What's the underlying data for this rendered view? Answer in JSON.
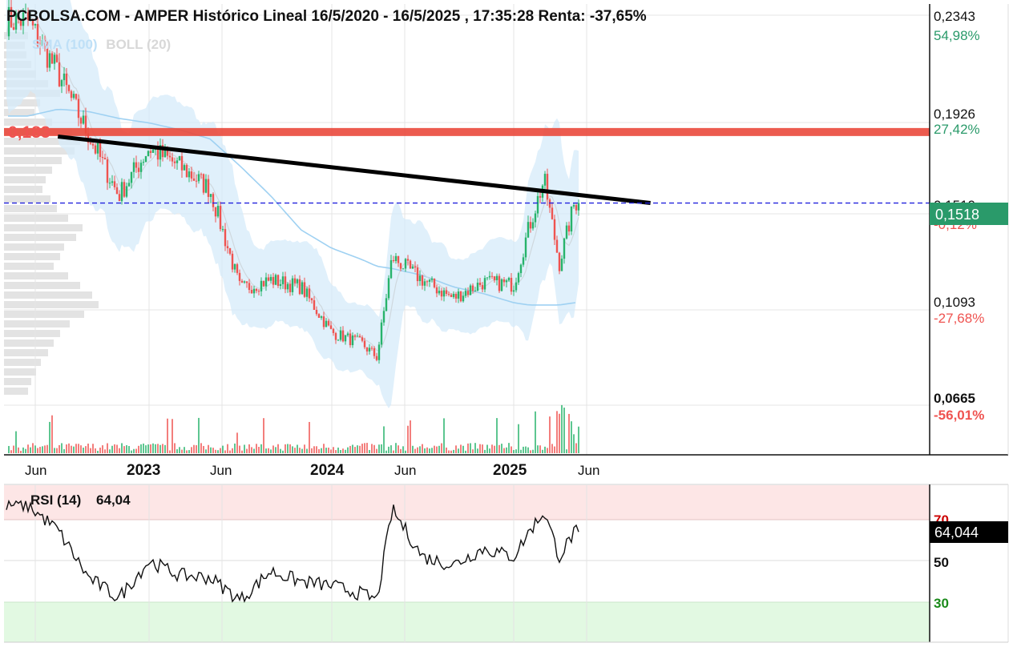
{
  "header": {
    "title": "PCBOLSA.COM - AMPER Histórico Lineal 16/5/2020 - 16/5/2025 , 17:35:28 Renta: -37,65%"
  },
  "indicators": {
    "sma_label": "SMA (100)",
    "boll_label": "BOLL (20)",
    "sma_color": "#bfe0f7",
    "boll_color": "#d8d8d8"
  },
  "colors": {
    "up": "#27b36b",
    "down": "#ef5350",
    "band_fill": "#d6ebfa",
    "sma_line": "#9fd1f2",
    "support_line": "#ea4a3c",
    "trend_line": "#000000",
    "current_line": "#2222dd",
    "current_badge": "#2a9a6a",
    "overbought_zone": "#fde6e6",
    "oversold_zone": "#e2f9e2",
    "volume_profile": "#dedede"
  },
  "x_axis": {
    "labels": [
      {
        "text": "Jun",
        "bold": false
      },
      {
        "text": "2023",
        "bold": true
      },
      {
        "text": "Jun",
        "bold": false
      },
      {
        "text": "2024",
        "bold": true
      },
      {
        "text": "Jun",
        "bold": false
      },
      {
        "text": "2025",
        "bold": true
      },
      {
        "text": "Jun",
        "bold": false
      }
    ]
  },
  "price_axis": {
    "levels": [
      {
        "price": "0,2343",
        "pct": "54,98%",
        "pct_color": "#2a9a6a",
        "bold": false
      },
      {
        "price": "0,1926",
        "pct": "27,42%",
        "pct_color": "#2a9a6a",
        "bold": false
      },
      {
        "price": "0,1093",
        "pct": "-27,68%",
        "pct_color": "#ef5350",
        "bold": false
      },
      {
        "price": "0,0665",
        "pct": "-56,01%",
        "pct_color": "#ef5350",
        "bold": true
      }
    ],
    "hidden_level": {
      "price": "0,1510",
      "pct": "-0,12%"
    }
  },
  "annotations": {
    "support_level": 0.183,
    "support_label": "0,183",
    "current_price": 0.1518,
    "current_label": "0,1518"
  },
  "rsi": {
    "label": "RSI (14)",
    "value": "64,04",
    "badge": "64,044",
    "levels": [
      "70",
      "50",
      "30"
    ],
    "level_colors": [
      "#cc0000",
      "#111111",
      "#1a8a1a"
    ]
  },
  "chart_data": [
    {
      "type": "line",
      "title": "PCBOLSA.COM - AMPER Histórico Lineal 16/5/2020 - 16/5/2025 , 17:35:28 Renta: -37,65%",
      "x": [
        "2022-05",
        "2022-07",
        "2022-09",
        "2022-11",
        "2023-01",
        "2023-03",
        "2023-05",
        "2023-07",
        "2023-09",
        "2023-11",
        "2024-01",
        "2024-03",
        "2024-04",
        "2024-05",
        "2024-07",
        "2024-09",
        "2024-11",
        "2025-01",
        "2025-02",
        "2025-03",
        "2025-04",
        "2025-05"
      ],
      "series": [
        {
          "name": "",
          "values": [
            0.232,
            0.209,
            0.182,
            0.155,
            0.176,
            0.168,
            0.158,
            0.114,
            0.118,
            0.115,
            0.095,
            0.09,
            0.084,
            0.128,
            0.118,
            0.11,
            0.117,
            0.116,
            0.141,
            0.162,
            0.125,
            0.152
          ]
        },
        {
          "name": "SMA (100)",
          "values": [
            0.19,
            0.193,
            0.192,
            0.189,
            0.187,
            0.184,
            0.18,
            0.168,
            0.155,
            0.14,
            0.132,
            0.127,
            0.124,
            0.123,
            0.12,
            0.115,
            0.112,
            0.108,
            0.107,
            0.107,
            0.107,
            0.108
          ]
        }
      ],
      "ylim": [
        0.0665,
        0.2343
      ],
      "y_tick_labels": [
        "0,2343",
        "0,1926",
        "0,1510",
        "0,1093",
        "0,0665"
      ],
      "x_tick_labels": [
        "Jun",
        "2023",
        "Jun",
        "2024",
        "Jun",
        "2025",
        "Jun"
      ],
      "horizontal_lines": [
        0.183,
        0.1518
      ],
      "trend_line": {
        "from": [
          "2022-07",
          0.181
        ],
        "to": [
          "2025-10",
          0.1518
        ]
      },
      "grid": true,
      "legend": "top-left"
    },
    {
      "type": "line",
      "title": "RSI (14)",
      "x": [
        "2022-05",
        "2022-07",
        "2022-09",
        "2022-11",
        "2023-01",
        "2023-03",
        "2023-05",
        "2023-07",
        "2023-09",
        "2023-11",
        "2024-01",
        "2024-03",
        "2024-04",
        "2024-05",
        "2024-07",
        "2024-09",
        "2024-11",
        "2025-01",
        "2025-02",
        "2025-03",
        "2025-04",
        "2025-05"
      ],
      "series": [
        {
          "name": "RSI (14)",
          "values": [
            77,
            65,
            42,
            32,
            50,
            43,
            42,
            31,
            45,
            40,
            38,
            34,
            31,
            75,
            52,
            48,
            56,
            52,
            64,
            74,
            52,
            64.04
          ]
        }
      ],
      "ylim": [
        25,
        80
      ],
      "y_tick_labels": [
        "70",
        "50",
        "30"
      ],
      "grid": true
    }
  ]
}
